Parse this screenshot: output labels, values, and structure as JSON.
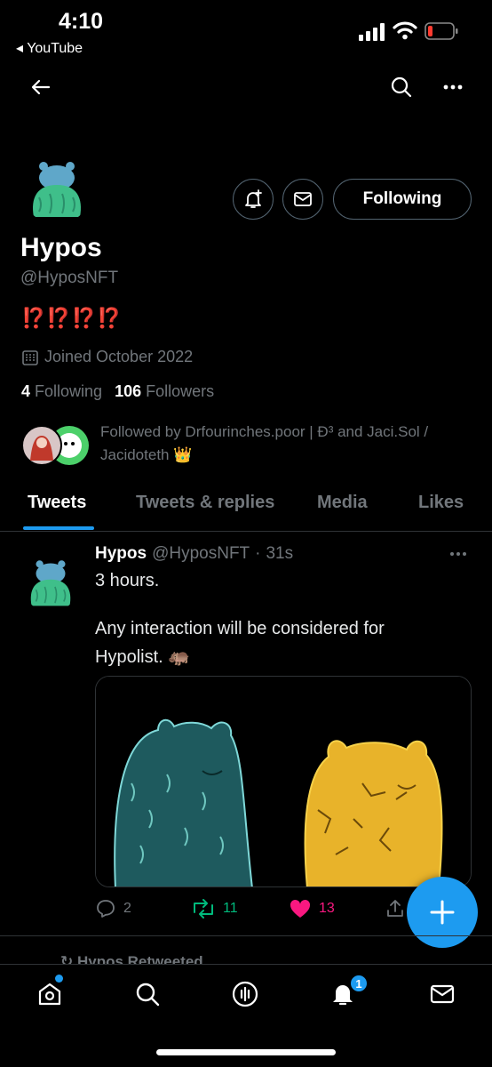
{
  "status_bar": {
    "time": "4:10",
    "back_app": "◂ YouTube"
  },
  "profile": {
    "display_name": "Hypos",
    "handle": "@HyposNFT",
    "bio": "⁉️⁉️⁉️⁉️",
    "joined": "Joined October 2022",
    "following_count": "4",
    "following_label": "Following",
    "followers_count": "106",
    "followers_label": "Followers",
    "followed_by": "Followed by Drfourinches.poor | Ð³ and Jaci.Sol / Jacidoteth 👑",
    "following_button": "Following"
  },
  "tabs": [
    {
      "label": "Tweets",
      "active": true
    },
    {
      "label": "Tweets & replies",
      "active": false
    },
    {
      "label": "Media",
      "active": false
    },
    {
      "label": "Likes",
      "active": false
    }
  ],
  "tweet": {
    "name": "Hypos",
    "handle": "@HyposNFT",
    "dot": "·",
    "time": "31s",
    "line1": "3 hours.",
    "line2": "Any interaction will be considered for",
    "line3": "Hypolist. 🦛",
    "replies": "2",
    "retweets": "11",
    "likes": "13"
  },
  "next_item": {
    "retweeted_label": "Hypos Retweeted"
  },
  "bottom_nav": {
    "notifications_badge": "1"
  },
  "colors": {
    "accent": "#1d9bf0",
    "retweet": "#00ba7c",
    "like": "#f91880",
    "muted": "#71767b"
  }
}
